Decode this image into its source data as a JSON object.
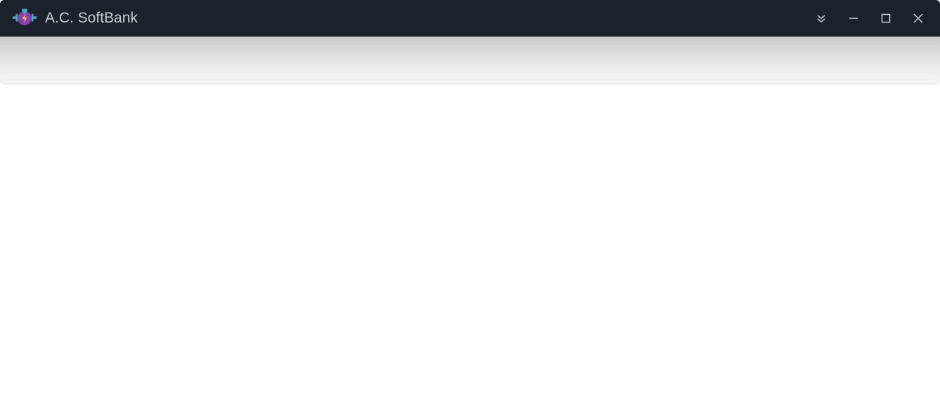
{
  "window": {
    "title": "A.C. SoftBank",
    "icon_name": "engine-icon",
    "colors": {
      "titlebar_bg": "#1b222c",
      "titlebar_fg": "#c9cdd3",
      "icon_purple": "#8a3eb0",
      "icon_cyan": "#4aa8c7",
      "icon_bolt": "#f5c542"
    }
  }
}
